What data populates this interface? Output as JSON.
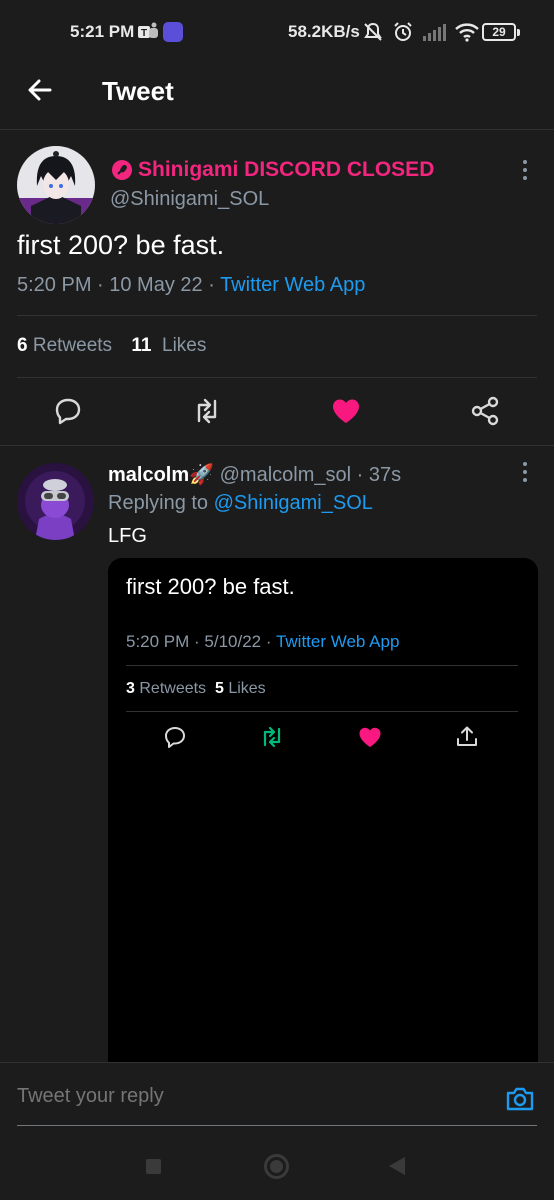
{
  "status_bar": {
    "time": "5:21 PM",
    "net_speed": "58.2KB/s",
    "battery": "29",
    "icons": [
      "teams-icon",
      "app-icon",
      "mute-icon",
      "alarm-icon",
      "signal-icon",
      "wifi-icon",
      "battery-icon"
    ]
  },
  "header": {
    "title": "Tweet",
    "back_icon": "arrow-left-icon"
  },
  "tweet": {
    "author_name": "Shinigami DISCORD CLOSED",
    "author_handle": "@Shinigami_SOL",
    "text": "first 200? be fast.",
    "time_date": "5:20 PM · 10 May 22 · ",
    "source": "Twitter Web App",
    "retweets_count": "6",
    "retweets_label": "Retweets",
    "likes_count": "11",
    "likes_label": "Likes",
    "name_color": "#f2267f",
    "liked": true
  },
  "reply": {
    "author_name": "malcolm🚀",
    "author_handle": "@malcolm_sol",
    "age": "37s",
    "replying_prefix": "Replying to ",
    "replying_handle": "@Shinigami_SOL",
    "text": "LFG",
    "embed": {
      "text": "first 200? be fast.",
      "time_date": "5:20 PM · 5/10/22 · ",
      "source": "Twitter Web App",
      "retweets_count": "3",
      "retweets_label": "Retweets",
      "likes_count": "5",
      "likes_label": "Likes"
    }
  },
  "composer": {
    "placeholder": "Tweet your reply"
  },
  "colors": {
    "accent": "#1d9bf0",
    "like": "#f91880",
    "retweet": "#00ba7c",
    "background": "#1c1c1c"
  }
}
